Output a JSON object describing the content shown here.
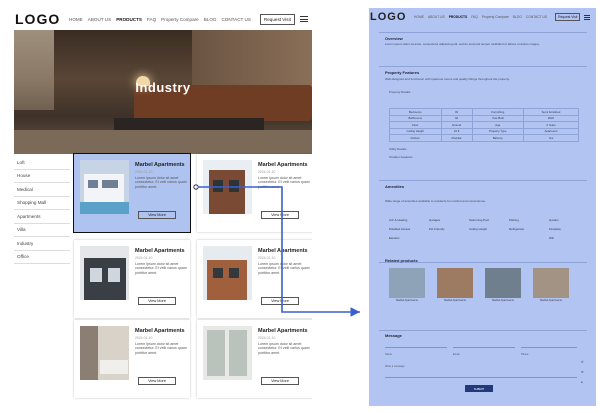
{
  "left_page": {
    "logo": "LOGO",
    "nav": [
      "HOME",
      "ABOUT US",
      "PRODUCTS",
      "FAQ",
      "Property Compare",
      "BLOG",
      "CONTACT US"
    ],
    "nav_active": "PRODUCTS",
    "visit_button": "Request Visit",
    "hero_title": "Industry",
    "sidebar": [
      "Loft",
      "House",
      "Medical",
      "Shopping Mall",
      "Apartments",
      "Villa",
      "Industry",
      "Office"
    ],
    "cards": [
      {
        "title": "Marbel Apartments",
        "date": "2024-01-10",
        "text": "Lorem ipsum dolor sit amet consectetur. Et velit varius quam porttitor amet.",
        "button": "View More"
      },
      {
        "title": "Marbel Apartments",
        "date": "2024-01-10",
        "text": "Lorem ipsum dolor sit amet consectetur. Et velit varius quam porttitor amet.",
        "button": "View More"
      },
      {
        "title": "Marbel Apartments",
        "date": "2024-01-10",
        "text": "Lorem ipsum dolor sit amet consectetur. Et velit varius quam porttitor amet.",
        "button": "View More"
      },
      {
        "title": "Marbel Apartments",
        "date": "2024-01-10",
        "text": "Lorem ipsum dolor sit amet consectetur. Et velit varius quam porttitor amet.",
        "button": "View More"
      },
      {
        "title": "Marbel Apartments",
        "date": "2024-01-10",
        "text": "Lorem ipsum dolor sit amet consectetur. Et velit varius quam porttitor amet.",
        "button": "View More"
      },
      {
        "title": "Marbel Apartments",
        "date": "2024-01-10",
        "text": "Lorem ipsum dolor sit amet consectetur. Et velit varius quam porttitor amet.",
        "button": "View More"
      }
    ]
  },
  "right_page": {
    "logo": "LOGO",
    "nav": [
      "HOME",
      "ABOUT US",
      "PRODUCTS",
      "FAQ",
      "Property Compare",
      "BLOG",
      "CONTACT US"
    ],
    "visit_button": "Request Visit",
    "overview_heading": "Overview",
    "overview_text": "Lorem ipsum dolor sit amet, consectetur adipiscing elit, sed do eiusmod tempor incididunt ut labore et dolore magna.",
    "features_heading": "Property Features",
    "features_text": "Well-designed and functional, with spacious rooms and quality fittings throughout the property.",
    "details_label": "Property Details",
    "details_rows": [
      [
        "Bedrooms",
        "03",
        "Furnishing",
        "Semi furnished"
      ],
      [
        "Bathrooms",
        "02",
        "Year Built",
        "2022"
      ],
      [
        "Floor",
        "Ground",
        "Age",
        "2 Years"
      ],
      [
        "Ceiling Height",
        "10 ft",
        "Property Type",
        "Apartment"
      ],
      [
        "Kitchen",
        "Modular",
        "Balcony",
        "Yes"
      ]
    ],
    "utility_label": "Utility Details",
    "outdoor_label": "Outdoor Features",
    "amenities_heading": "Amenities",
    "amenities_text": "Wide range of amenities available to residents for comfort and convenience.",
    "amenities": [
      "A/C & Heating",
      "Garages",
      "Swimming Pool",
      "Parking",
      "Garden",
      "Disabled Access",
      "Pet Friendly",
      "Ceiling Height",
      "Refrigerator",
      "Fireplace",
      "Elevator",
      "",
      "",
      "",
      "Wifi"
    ],
    "related_heading": "Related products",
    "related": [
      "Marbel Apartments",
      "Marbel Apartments",
      "Marbel Apartments",
      "Marbel Apartments"
    ],
    "message_heading": "Message",
    "form_fields": [
      "Name",
      "Email",
      "Phone"
    ],
    "message_placeholder": "Write a message",
    "submit": "SUBMIT"
  },
  "colors": {
    "highlight": "#b2c5f2",
    "arrow": "#3a5fcd",
    "outline": "#111111"
  }
}
